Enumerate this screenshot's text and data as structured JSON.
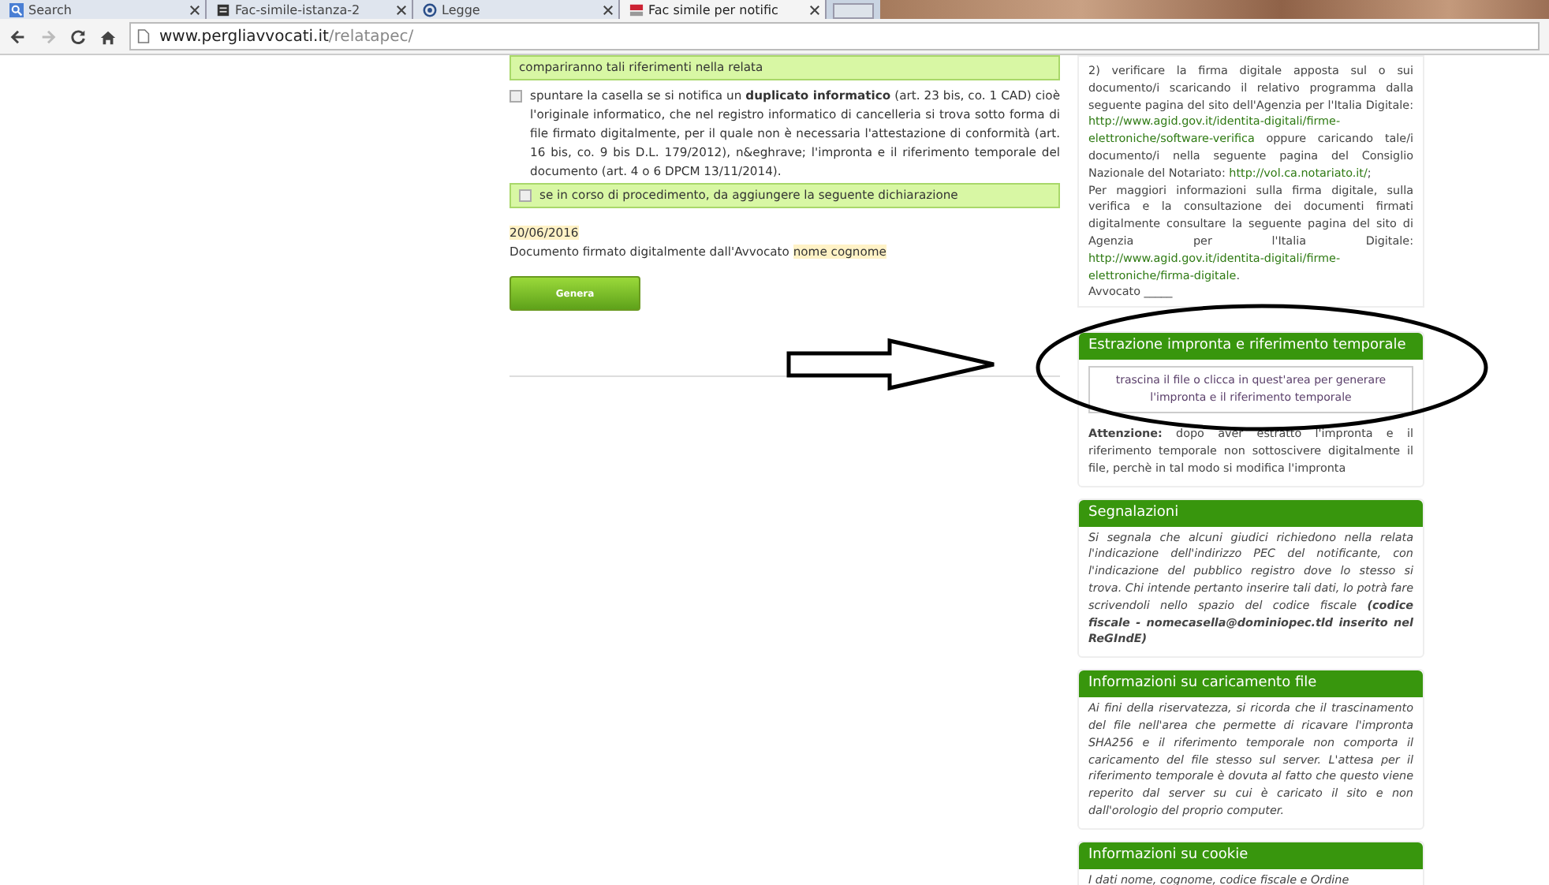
{
  "browser": {
    "tabs": [
      {
        "title": "Search",
        "kind": "search",
        "selected": false
      },
      {
        "title": "Fac-simile-istanza-2",
        "kind": "document",
        "selected": false
      },
      {
        "title": "Legge",
        "kind": "target",
        "selected": false
      },
      {
        "title": "Fac simile per notific",
        "kind": "site",
        "selected": true
      }
    ],
    "url": {
      "host": "www.pergliavvocati.it",
      "path": "/relatapec/"
    }
  },
  "form": {
    "notice": "compariranno tali riferimenti nella relata",
    "options": [
      {
        "kind": "plain",
        "checked": false,
        "text": "spuntare la casella se si notifica un **duplicato informatico** (art. 23 bis, co. 1 CAD) cioè l'originale informatico, che nel registro informatico di cancelleria si trova sotto forma di file firmato digitalmente, per il quale non è necessaria l'attestazione di conformità (art. 16 bis, co. 9 bis D.L. 179/2012), n&eghrave; l'impronta e il riferimento temporale del documento (art. 4 o 6 DPCM 13/11/2014)."
      },
      {
        "kind": "boxed",
        "checked": false,
        "text": "se in corso di procedimento, da aggiungere la seguente dichiarazione"
      }
    ],
    "date": "20/06/2016",
    "signature": "Documento firmato digitalmente dall'Avvocato",
    "signer": "nome cognome",
    "button": "Genera"
  },
  "sidebar": {
    "instructions": [
      [
        {
          "kind": "text",
          "text": "2) verificare la firma digitale apposta sul o sui documento/i scaricando il relativo programma dalla seguente pagina del sito dell'Agenzia per l'Italia Digitale: "
        },
        {
          "kind": "link",
          "text": "http://www.agid.gov.it/identita-digitali/firme-"
        },
        {
          "kind": "link",
          "text": "elettroniche/software-verifica"
        },
        {
          "kind": "text",
          "text": " oppure caricando tale/i documento/i nella seguente pagina del Consiglio Nazionale del Notariato: "
        },
        {
          "kind": "link",
          "text": "http://vol.ca.notariato.it/"
        },
        {
          "kind": "text",
          "text": ";"
        }
      ],
      [
        {
          "kind": "text",
          "text": "Per maggiori informazioni sulla firma digitale, sulla verifica e la consultazione dei documenti firmati digitalmente consultare la seguente pagina del sito di Agenzia per l'Italia Digitale: "
        },
        {
          "kind": "link",
          "text": "http://www.agid.gov.it/identita-digitali/firme-"
        },
        {
          "kind": "link",
          "text": "elettroniche/firma-digitale"
        },
        {
          "kind": "text",
          "text": "."
        }
      ],
      [
        {
          "kind": "text",
          "text": "Avvocato _____"
        }
      ]
    ],
    "panels": [
      {
        "kind": "upload",
        "title": "Estrazione impronta e riferimento temporale",
        "dropzone": "trascina il file o clicca in quest'area per generare l'impronta e il riferimento temporale",
        "body": "**Attenzione:** dopo aver estratto l'impronta e il riferimento temporale non sottoscivere digitalmente il file, perchè in tal modo si modifica l'impronta"
      },
      {
        "kind": "note",
        "title": "Segnalazioni",
        "body": "Si segnala che alcuni giudici richiedono nella relata l'indicazione dell'indirizzo PEC del notificante, con l'indicazione del pubblico registro dove lo stesso si trova. Chi intende pertanto inserire tali dati, lo potrà fare scrivendoli nello spazio del codice fiscale **(codice fiscale - nomecasella@dominiopec.tld inserito nel ReGIndE)**"
      },
      {
        "kind": "note",
        "title": "Informazioni su caricamento file",
        "body": "Ai fini della riservatezza, si ricorda che il trascinamento del file nell'area che permette di ricavare l'impronta SHA256 e il riferimento temporale non comporta il caricamento del file stesso sul server. L'attesa per il riferimento temporale è dovuta al fatto che questo viene reperito dal server su cui è caricato il sito e non dall'orologio del proprio computer."
      },
      {
        "kind": "note",
        "title": "Informazioni su cookie",
        "body": "I dati nome, cognome, codice fiscale e Ordine"
      }
    ]
  }
}
